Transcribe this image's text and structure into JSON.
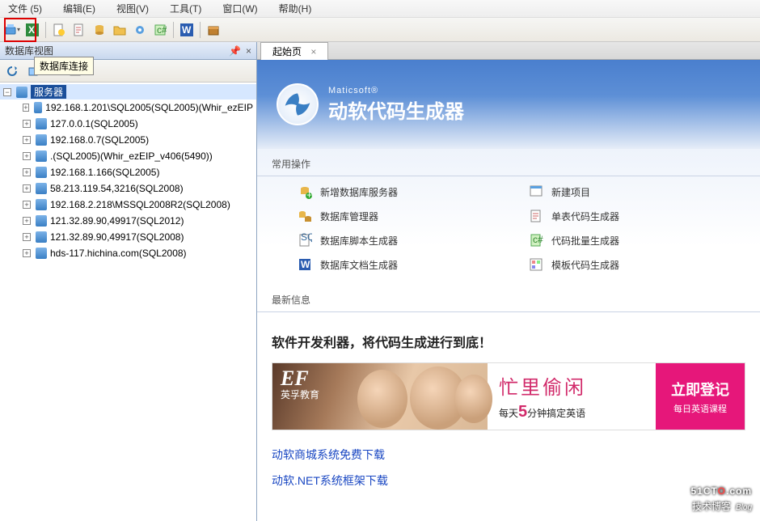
{
  "menu": {
    "file": "文件 (5)",
    "edit": "编辑(E)",
    "view": "视图(V)",
    "tools": "工具(T)",
    "window": "窗口(W)",
    "help": "帮助(H)"
  },
  "tooltip": "数据库连接",
  "left_panel": {
    "title": "数据库视图",
    "pin": "📌",
    "close": "×",
    "root": "服务器",
    "servers": [
      "192.168.1.201\\SQL2005(SQL2005)(Whir_ezEIP",
      "127.0.0.1(SQL2005)",
      "192.168.0.7(SQL2005)",
      ".(SQL2005)(Whir_ezEIP_v406(5490))",
      "192.168.1.166(SQL2005)",
      "58.213.119.54,3216(SQL2008)",
      "192.168.2.218\\MSSQL2008R2(SQL2008)",
      "121.32.89.90,49917(SQL2012)",
      "121.32.89.90,49917(SQL2008)",
      "hds-117.hichina.com(SQL2008)"
    ]
  },
  "tab": {
    "label": "起始页",
    "x": "×"
  },
  "brand": {
    "sub": "Maticsoft®",
    "title": "动软代码生成器"
  },
  "sections": {
    "ops": "常用操作",
    "news": "最新信息"
  },
  "ops": [
    {
      "label": "新增数据库服务器"
    },
    {
      "label": "新建项目"
    },
    {
      "label": "数据库管理器"
    },
    {
      "label": "单表代码生成器"
    },
    {
      "label": "数据库脚本生成器"
    },
    {
      "label": "代码批量生成器"
    },
    {
      "label": "数据库文档生成器"
    },
    {
      "label": "模板代码生成器"
    }
  ],
  "news_headline": "软件开发利器，将代码生成进行到底！",
  "ad": {
    "brand_big": "EF",
    "brand_small": "英孚教育",
    "line1": "忙里偷闲",
    "line2_pre": "每天",
    "line2_em": "5",
    "line2_post": "分钟搞定英语",
    "cta1": "立即登记",
    "cta2": "每日英语课程"
  },
  "links": [
    "动软商城系统免费下载",
    "动软.NET系统框架下载"
  ],
  "watermark": {
    "line1a": "51CT",
    "line1b": "O",
    "line1c": ".com",
    "line2": "技术博客",
    "line2b": "Blog"
  },
  "colors": {
    "accent": "#1846c2",
    "red": "#d00"
  }
}
